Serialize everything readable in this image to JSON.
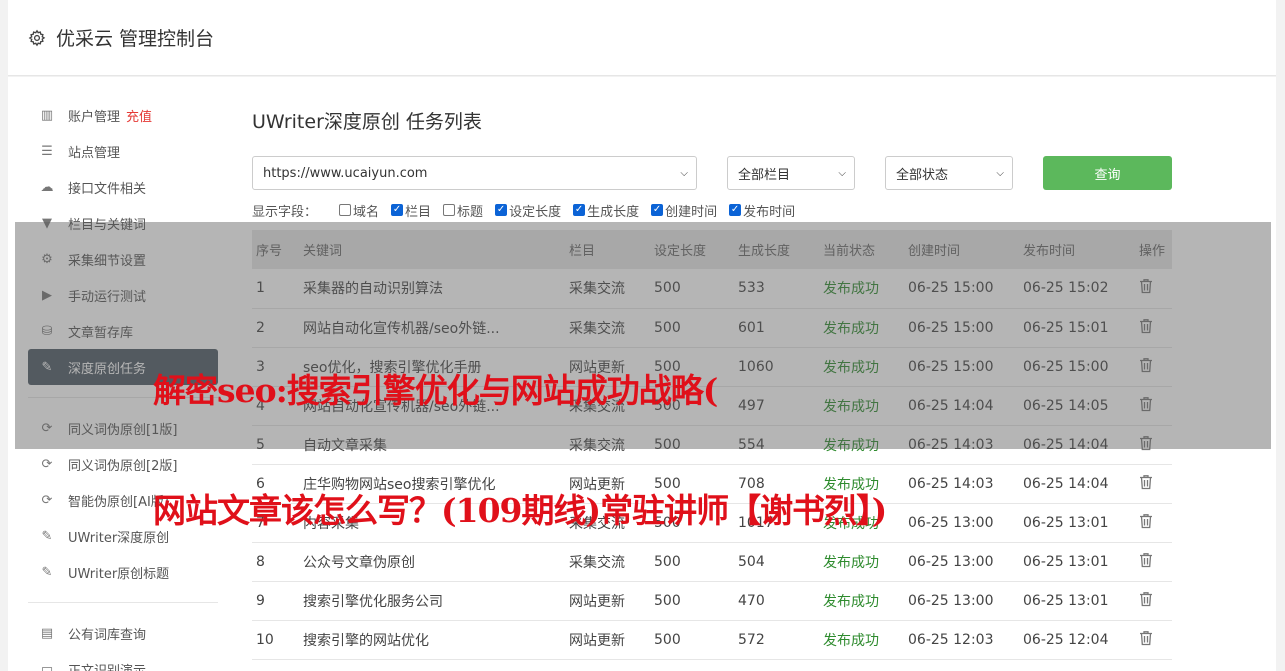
{
  "header": {
    "title": "优采云 管理控制台",
    "icon": "gear-icon"
  },
  "sidebar": {
    "items": [
      {
        "label": "账户管理",
        "badge": "充值",
        "icon": "bar-chart-icon"
      },
      {
        "label": "站点管理",
        "icon": "server-icon"
      },
      {
        "label": "接口文件相关",
        "icon": "cloud-upload-icon"
      },
      {
        "label": "栏目与关键词",
        "icon": "filter-icon"
      },
      {
        "label": "采集细节设置",
        "icon": "cogs-icon"
      },
      {
        "label": "手动运行测试",
        "icon": "play-circle-icon"
      },
      {
        "label": "文章暂存库",
        "icon": "database-icon"
      },
      {
        "label": "深度原创任务",
        "icon": "edit-icon",
        "active": true
      },
      {
        "label": "同义词伪原创[1版]",
        "icon": "refresh-icon"
      },
      {
        "label": "同义词伪原创[2版]",
        "icon": "refresh-icon"
      },
      {
        "label": "智能伪原创[AI版]",
        "icon": "refresh-icon"
      },
      {
        "label": "UWriter深度原创",
        "icon": "edit-icon"
      },
      {
        "label": "UWriter原创标题",
        "icon": "edit-icon"
      },
      {
        "label": "公有词库查询",
        "icon": "book-icon"
      },
      {
        "label": "正文识别演示",
        "icon": "monitor-icon"
      }
    ]
  },
  "main": {
    "title": "UWriter深度原创 任务列表",
    "site_select": "https://www.ucaiyun.com",
    "column_select": "全部栏目",
    "status_select": "全部状态",
    "query_label": "查询",
    "fields_label": "显示字段：",
    "fields": [
      {
        "label": "域名",
        "checked": false
      },
      {
        "label": "栏目",
        "checked": true
      },
      {
        "label": "标题",
        "checked": false
      },
      {
        "label": "设定长度",
        "checked": true
      },
      {
        "label": "生成长度",
        "checked": true
      },
      {
        "label": "创建时间",
        "checked": true
      },
      {
        "label": "发布时间",
        "checked": true
      }
    ],
    "table": {
      "headers": [
        "序号",
        "关键词",
        "栏目",
        "设定长度",
        "生成长度",
        "当前状态",
        "创建时间",
        "发布时间",
        "操作"
      ],
      "rows": [
        [
          "1",
          "采集器的自动识别算法",
          "采集交流",
          "500",
          "533",
          "发布成功",
          "06-25 15:00",
          "06-25 15:02"
        ],
        [
          "2",
          "网站自动化宣传机器/seo外链...",
          "采集交流",
          "500",
          "601",
          "发布成功",
          "06-25 15:00",
          "06-25 15:01"
        ],
        [
          "3",
          "seo优化，搜索引擎优化手册",
          "网站更新",
          "500",
          "1060",
          "发布成功",
          "06-25 15:00",
          "06-25 15:00"
        ],
        [
          "4",
          "网站自动化宣传机器/seo外链...",
          "采集交流",
          "500",
          "497",
          "发布成功",
          "06-25 14:04",
          "06-25 14:05"
        ],
        [
          "5",
          "自动文章采集",
          "采集交流",
          "500",
          "554",
          "发布成功",
          "06-25 14:03",
          "06-25 14:04"
        ],
        [
          "6",
          "庄华购物网站seo搜索引擎优化",
          "网站更新",
          "500",
          "708",
          "发布成功",
          "06-25 14:03",
          "06-25 14:04"
        ],
        [
          "7",
          "内容采集",
          "采集交流",
          "500",
          "1017",
          "发布成功",
          "06-25 13:00",
          "06-25 13:01"
        ],
        [
          "8",
          "公众号文章伪原创",
          "采集交流",
          "500",
          "504",
          "发布成功",
          "06-25 13:00",
          "06-25 13:01"
        ],
        [
          "9",
          "搜索引擎优化服务公司",
          "网站更新",
          "500",
          "470",
          "发布成功",
          "06-25 13:00",
          "06-25 13:01"
        ],
        [
          "10",
          "搜索引擎的网站优化",
          "网站更新",
          "500",
          "572",
          "发布成功",
          "06-25 12:03",
          "06-25 12:04"
        ]
      ],
      "action_icon": "trash-icon"
    }
  },
  "overlay": {
    "line1": "解密seo:搜索引擎优化与网站成功战略(",
    "line2": "网站文章该怎么写？(109期线)常驻讲师【谢书烈】)"
  },
  "colors": {
    "accent_green": "#5cb85c",
    "active_sidebar": "#4e5a65",
    "status_ok": "#2e8b2e",
    "banner_red": "#e0101a"
  }
}
